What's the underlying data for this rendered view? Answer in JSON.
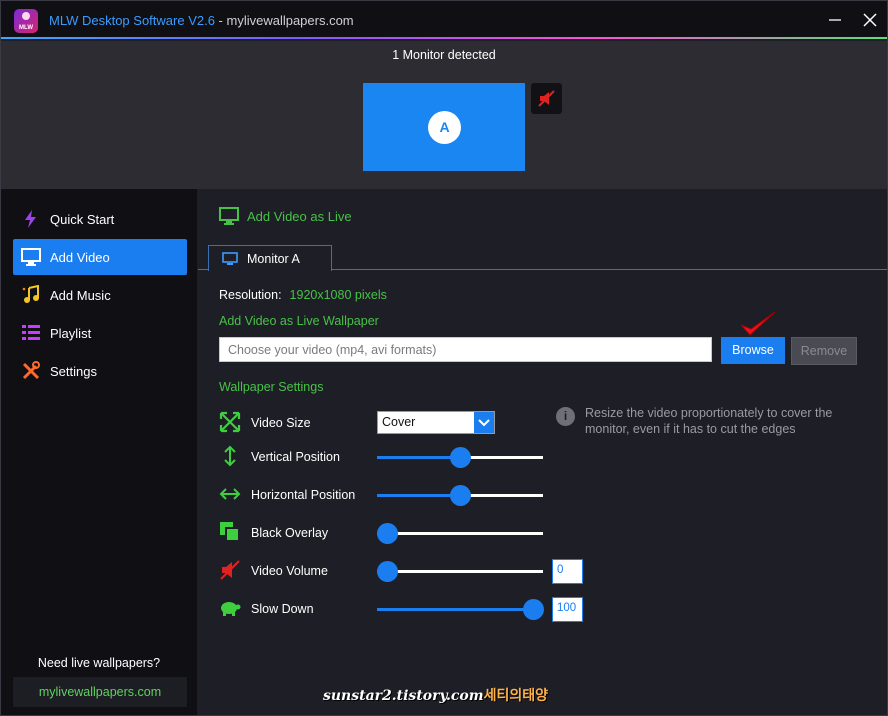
{
  "window": {
    "app_name": "MLW Desktop Software V2.6",
    "title_suffix": " - mylivewallpapers.com",
    "logo_text": "MLW"
  },
  "monitor_panel": {
    "detected_text": "1 Monitor detected",
    "monitor_label": "A"
  },
  "sidebar": {
    "items": [
      {
        "label": "Quick Start",
        "icon": "lightning-icon",
        "active": false
      },
      {
        "label": "Add Video",
        "icon": "monitor-icon",
        "active": true
      },
      {
        "label": "Add Music",
        "icon": "music-notes-icon",
        "active": false
      },
      {
        "label": "Playlist",
        "icon": "list-icon",
        "active": false
      },
      {
        "label": "Settings",
        "icon": "tools-icon",
        "active": false
      }
    ],
    "promo_text": "Need live wallpapers?",
    "promo_link": "mylivewallpapers.com"
  },
  "main": {
    "header": "Add Video as Live",
    "tab_label": "Monitor A",
    "resolution_label": "Resolution:",
    "resolution_value": "1920x1080 pixels",
    "section_label": "Add Video as Live Wallpaper",
    "file_placeholder": "Choose your video (mp4, avi formats)",
    "browse_label": "Browse",
    "remove_label": "Remove",
    "settings_label": "Wallpaper Settings",
    "video_size": {
      "label": "Video Size",
      "selected": "Cover",
      "info": "Resize the video proportionately to cover the monitor, even if it has to cut the edges"
    },
    "vertical_position": {
      "label": "Vertical Position",
      "level": 0.5
    },
    "horizontal_position": {
      "label": "Horizontal Position",
      "level": 0.5
    },
    "black_overlay": {
      "label": "Black Overlay",
      "level": 0
    },
    "video_volume": {
      "label": "Video Volume",
      "level": 0,
      "value": "0"
    },
    "slow_down": {
      "label": "Slow Down",
      "level": 1,
      "value": "100"
    }
  },
  "watermark": {
    "text": "sunstar2.tistory.com",
    "korean": "세티의태양"
  },
  "colors": {
    "accent_blue": "#1a7ef0",
    "label_green": "#47c247",
    "background": "#1e1e26"
  }
}
